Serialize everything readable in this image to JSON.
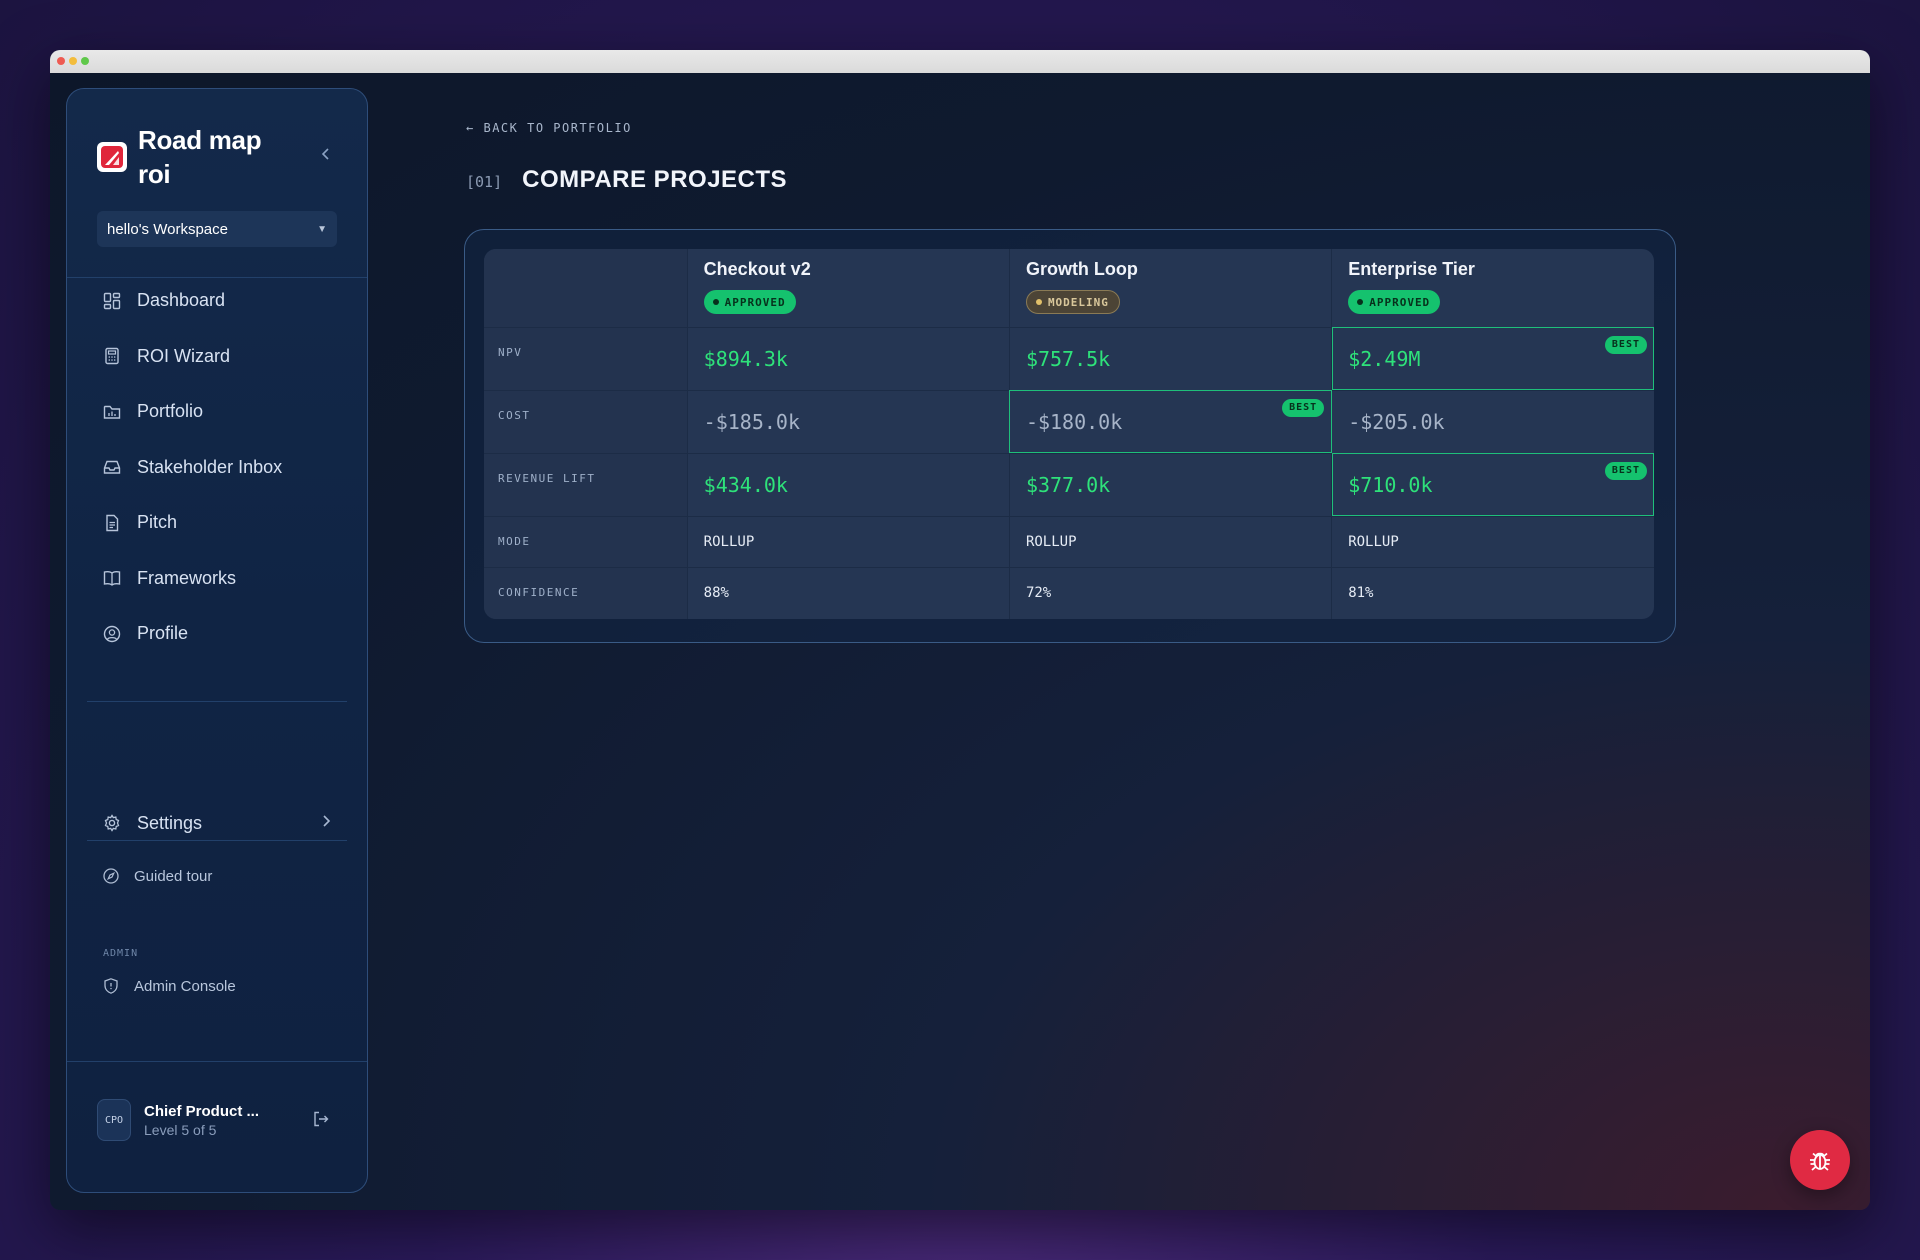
{
  "app": {
    "brand_name": "Road map roi",
    "workspace": "hello's Workspace"
  },
  "sidebar": {
    "items": [
      {
        "label": "Dashboard",
        "icon": "dashboard-icon"
      },
      {
        "label": "ROI Wizard",
        "icon": "calculator-icon"
      },
      {
        "label": "Portfolio",
        "icon": "folder-chart-icon"
      },
      {
        "label": "Stakeholder Inbox",
        "icon": "inbox-icon"
      },
      {
        "label": "Pitch",
        "icon": "document-icon"
      },
      {
        "label": "Frameworks",
        "icon": "book-icon"
      },
      {
        "label": "Profile",
        "icon": "user-circle-icon"
      }
    ],
    "settings_label": "Settings",
    "guided_tour_label": "Guided tour",
    "admin_section_label": "ADMIN",
    "admin_console_label": "Admin Console",
    "user": {
      "initials": "CPO",
      "name": "Chief Product ...",
      "level": "Level 5 of 5"
    }
  },
  "main": {
    "back_label": "BACK TO PORTFOLIO",
    "page_index": "[01]",
    "page_title": "COMPARE PROJECTS",
    "best_label": "BEST",
    "projects": [
      {
        "name": "Checkout v2",
        "status": "APPROVED"
      },
      {
        "name": "Growth Loop",
        "status": "MODELING"
      },
      {
        "name": "Enterprise Tier",
        "status": "APPROVED"
      }
    ],
    "rows": {
      "npv": {
        "label": "NPV",
        "values": [
          "$894.3k",
          "$757.5k",
          "$2.49M"
        ],
        "best_index": 2
      },
      "cost": {
        "label": "COST",
        "values": [
          "-$185.0k",
          "-$180.0k",
          "-$205.0k"
        ],
        "best_index": 1
      },
      "revenue_lift": {
        "label": "REVENUE LIFT",
        "values": [
          "$434.0k",
          "$377.0k",
          "$710.0k"
        ],
        "best_index": 2
      },
      "mode": {
        "label": "MODE",
        "values": [
          "ROLLUP",
          "ROLLUP",
          "ROLLUP"
        ]
      },
      "confidence": {
        "label": "CONFIDENCE",
        "values": [
          "88%",
          "72%",
          "81%"
        ]
      }
    }
  },
  "colors": {
    "accent_green": "#2ee27a",
    "badge_green": "#15c26e",
    "bug_button": "#e02a43"
  }
}
